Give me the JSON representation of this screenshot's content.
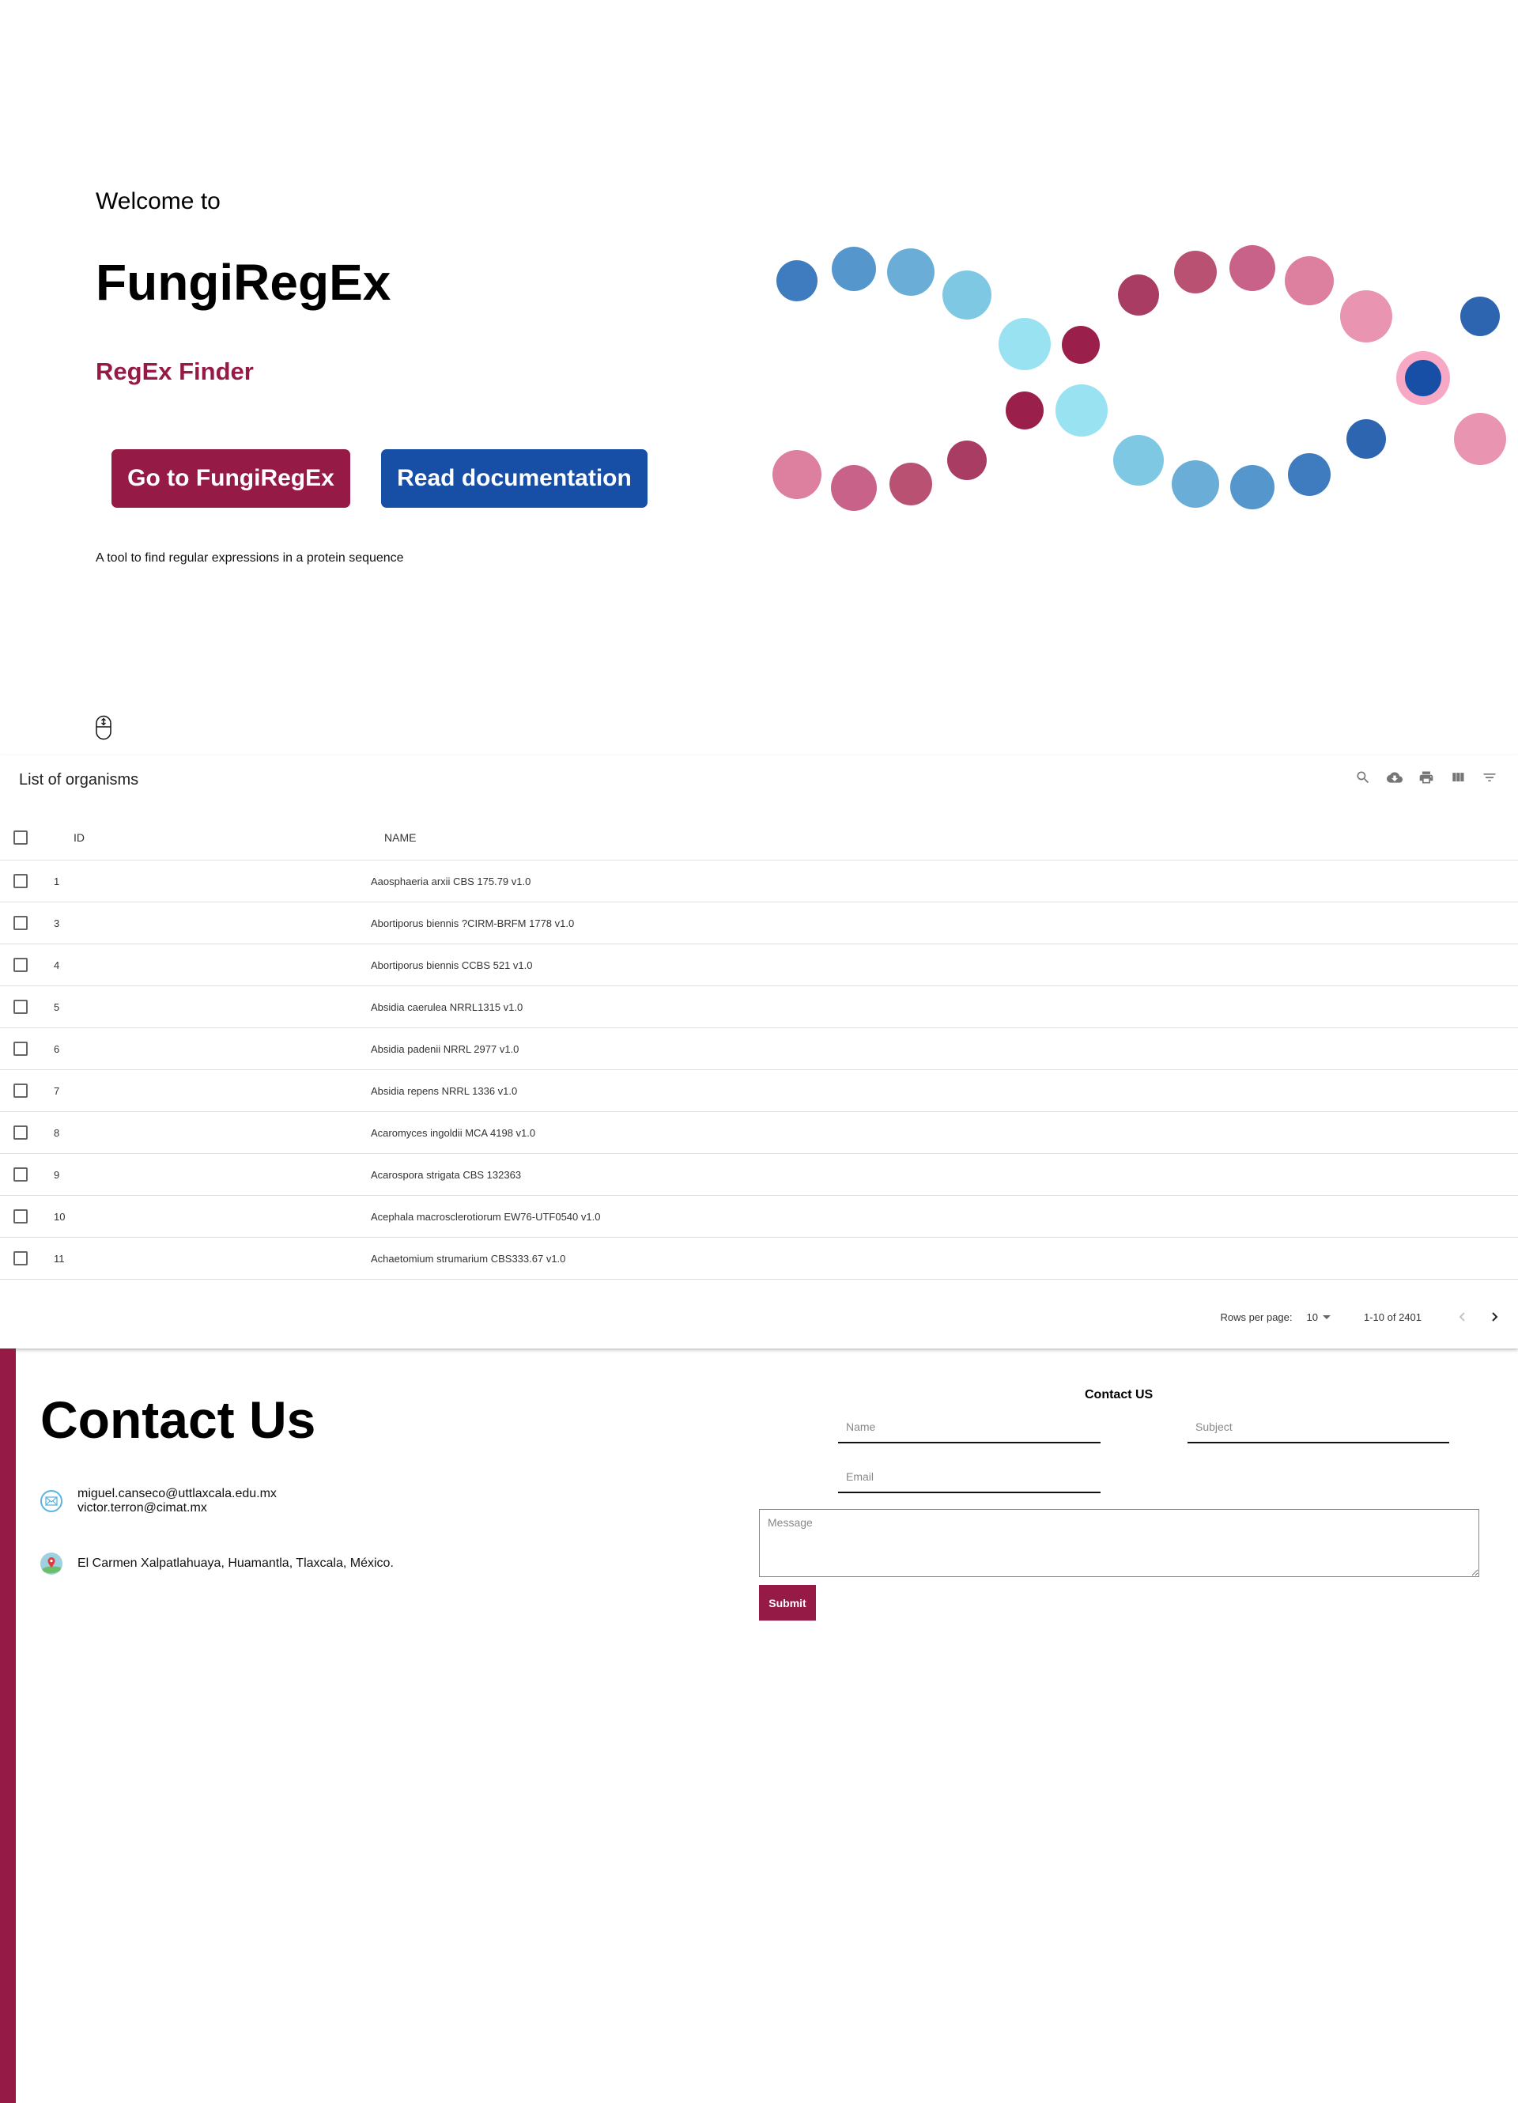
{
  "hero": {
    "welcome": "Welcome to",
    "brand": "FungiRegEx",
    "subtitle": "RegEx Finder",
    "go_button": "Go to FungiRegEx",
    "docs_button": "Read documentation",
    "tagline": "A tool to find regular expressions in a protein sequence",
    "scroll_icon": "mouse-scroll-icon"
  },
  "colors": {
    "brand_maroon": "#951a45",
    "brand_blue": "#174ea6"
  },
  "decor_dots": [
    {
      "color": "#3f7bbf"
    },
    {
      "color": "#5596cc"
    },
    {
      "color": "#6aaed8"
    },
    {
      "color": "#7ec8e3"
    },
    {
      "color": "#98e2f1"
    },
    {
      "color": "#9b1f4b"
    },
    {
      "color": "#dd7f9f"
    },
    {
      "color": "#c96288"
    },
    {
      "color": "#b95173"
    },
    {
      "color": "#a83c62"
    },
    {
      "color": "#9b1f4b"
    },
    {
      "color": "#98e2f1"
    },
    {
      "color": "#a83c62"
    },
    {
      "color": "#b95173"
    },
    {
      "color": "#c96288"
    },
    {
      "color": "#dd7f9f"
    },
    {
      "color": "#e995b1"
    },
    {
      "color": "#2d65b0"
    },
    {
      "color": "#7ec8e3"
    },
    {
      "color": "#6aaed8"
    },
    {
      "color": "#5596cc"
    },
    {
      "color": "#3f7bbf"
    },
    {
      "color": "#2d65b0"
    },
    {
      "color": "#e995b1"
    },
    {
      "color": "#174ea6",
      "ring": "#f7a8c4"
    }
  ],
  "table": {
    "title": "List of organisms",
    "toolbar": [
      {
        "icon": "search-icon",
        "label": "Search"
      },
      {
        "icon": "cloud-download-icon",
        "label": "Download CSV"
      },
      {
        "icon": "print-icon",
        "label": "Print"
      },
      {
        "icon": "view-columns-icon",
        "label": "View Columns"
      },
      {
        "icon": "filter-icon",
        "label": "Filter Table"
      }
    ],
    "columns": [
      "ID",
      "NAME"
    ],
    "rows": [
      {
        "id": "1",
        "name": "Aaosphaeria arxii CBS 175.79 v1.0"
      },
      {
        "id": "3",
        "name": "Abortiporus biennis ?CIRM-BRFM 1778 v1.0"
      },
      {
        "id": "4",
        "name": "Abortiporus biennis CCBS 521 v1.0"
      },
      {
        "id": "5",
        "name": "Absidia caerulea NRRL1315 v1.0"
      },
      {
        "id": "6",
        "name": "Absidia padenii NRRL 2977 v1.0"
      },
      {
        "id": "7",
        "name": "Absidia repens NRRL 1336 v1.0"
      },
      {
        "id": "8",
        "name": "Acaromyces ingoldii MCA 4198 v1.0"
      },
      {
        "id": "9",
        "name": "Acarospora strigata CBS 132363"
      },
      {
        "id": "10",
        "name": "Acephala macrosclerotiorum EW76-UTF0540 v1.0"
      },
      {
        "id": "11",
        "name": "Achaetomium strumarium CBS333.67 v1.0"
      }
    ],
    "pagination": {
      "rows_per_page_label": "Rows per page:",
      "rows_per_page": "10",
      "range": "1-10 of 2401"
    }
  },
  "contact": {
    "title": "Contact Us",
    "emails": [
      "miguel.canseco@uttlaxcala.edu.mx",
      "victor.terron@cimat.mx"
    ],
    "address": "El Carmen Xalpatlahuaya, Huamantla, Tlaxcala, México.",
    "form": {
      "title": "Contact US",
      "name_placeholder": "Name",
      "subject_placeholder": "Subject",
      "email_placeholder": "Email",
      "message_placeholder": "Message",
      "name_value": "",
      "subject_value": "",
      "email_value": "",
      "message_value": "",
      "submit_label": "Submit"
    }
  }
}
